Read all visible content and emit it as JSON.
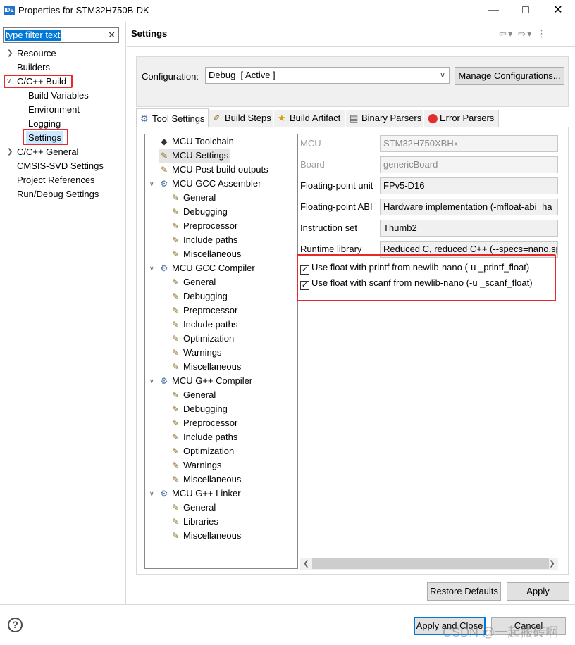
{
  "window": {
    "app_icon": "IDE",
    "title": "Properties for STM32H750B-DK",
    "minimize_icon": "minimize-icon",
    "maximize_icon": "maximize-icon",
    "close_icon": "close-icon"
  },
  "sidebar": {
    "filter_text": "type filter text",
    "items": [
      {
        "label": "Resource",
        "expand": "collapsed"
      },
      {
        "label": "Builders"
      },
      {
        "label": "C/C++ Build",
        "expand": "expanded",
        "highlighted": true
      },
      {
        "label": "Build Variables"
      },
      {
        "label": "Environment"
      },
      {
        "label": "Logging"
      },
      {
        "label": "Settings",
        "selected": true,
        "highlighted": true
      },
      {
        "label": "C/C++ General",
        "expand": "collapsed"
      },
      {
        "label": "CMSIS-SVD Settings"
      },
      {
        "label": "Project References"
      },
      {
        "label": "Run/Debug Settings"
      }
    ]
  },
  "header": {
    "title": "Settings",
    "nav_icons": [
      "back-arrow-icon",
      "chevron-down-icon",
      "forward-arrow-icon",
      "chevron-down-icon",
      "menu-icon"
    ]
  },
  "configuration": {
    "label": "Configuration:",
    "value": "Debug  [ Active ]",
    "manage_button": "Manage Configurations..."
  },
  "tabs": [
    {
      "label": "Tool Settings",
      "icon": "gear-icon",
      "active": true
    },
    {
      "label": "Build Steps",
      "icon": "steps-icon"
    },
    {
      "label": "Build Artifact",
      "icon": "trophy-icon"
    },
    {
      "label": "Binary Parsers",
      "icon": "binary-icon"
    },
    {
      "label": "Error Parsers",
      "icon": "error-icon"
    }
  ],
  "tool_tree": [
    {
      "label": "MCU Toolchain",
      "icon": "chip-icon"
    },
    {
      "label": "MCU Settings",
      "icon": "settings-icon",
      "selected": true
    },
    {
      "label": "MCU Post build outputs",
      "icon": "settings-icon"
    },
    {
      "label": "MCU GCC Assembler",
      "icon": "gear-icon",
      "expand": "expanded"
    },
    {
      "label": "General",
      "icon": "settings-icon"
    },
    {
      "label": "Debugging",
      "icon": "settings-icon"
    },
    {
      "label": "Preprocessor",
      "icon": "settings-icon"
    },
    {
      "label": "Include paths",
      "icon": "settings-icon"
    },
    {
      "label": "Miscellaneous",
      "icon": "settings-icon"
    },
    {
      "label": "MCU GCC Compiler",
      "icon": "gear-icon",
      "expand": "expanded"
    },
    {
      "label": "General",
      "icon": "settings-icon"
    },
    {
      "label": "Debugging",
      "icon": "settings-icon"
    },
    {
      "label": "Preprocessor",
      "icon": "settings-icon"
    },
    {
      "label": "Include paths",
      "icon": "settings-icon"
    },
    {
      "label": "Optimization",
      "icon": "settings-icon"
    },
    {
      "label": "Warnings",
      "icon": "settings-icon"
    },
    {
      "label": "Miscellaneous",
      "icon": "settings-icon"
    },
    {
      "label": "MCU G++ Compiler",
      "icon": "gear-icon",
      "expand": "expanded"
    },
    {
      "label": "General",
      "icon": "settings-icon"
    },
    {
      "label": "Debugging",
      "icon": "settings-icon"
    },
    {
      "label": "Preprocessor",
      "icon": "settings-icon"
    },
    {
      "label": "Include paths",
      "icon": "settings-icon"
    },
    {
      "label": "Optimization",
      "icon": "settings-icon"
    },
    {
      "label": "Warnings",
      "icon": "settings-icon"
    },
    {
      "label": "Miscellaneous",
      "icon": "settings-icon"
    },
    {
      "label": "MCU G++ Linker",
      "icon": "gear-icon",
      "expand": "expanded"
    },
    {
      "label": "General",
      "icon": "settings-icon"
    },
    {
      "label": "Libraries",
      "icon": "settings-icon"
    },
    {
      "label": "Miscellaneous",
      "icon": "settings-icon"
    }
  ],
  "mcu_settings": {
    "mcu": {
      "label": "MCU",
      "value": "STM32H750XBHx"
    },
    "board": {
      "label": "Board",
      "value": "genericBoard"
    },
    "fpu": {
      "label": "Floating-point unit",
      "value": "FPv5-D16"
    },
    "fpa": {
      "label": "Floating-point ABI",
      "value": "Hardware implementation (-mfloat-abi=ha"
    },
    "iset": {
      "label": "Instruction set",
      "value": "Thumb2"
    },
    "runtime": {
      "label": "Runtime library",
      "value": "Reduced C, reduced C++ (--specs=nano.sp"
    },
    "printf_float": {
      "label": "Use float with printf from newlib-nano (-u _printf_float)",
      "checked": true
    },
    "scanf_float": {
      "label": "Use float with scanf from newlib-nano (-u _scanf_float)",
      "checked": true
    }
  },
  "buttons": {
    "restore_defaults": "Restore Defaults",
    "apply": "Apply",
    "apply_and_close": "Apply and Close",
    "cancel": "Cancel"
  },
  "watermark": "CSDN @一起搬砖啊",
  "colors": {
    "highlight_red": "#e8282a",
    "selection_blue": "#0078d7"
  }
}
